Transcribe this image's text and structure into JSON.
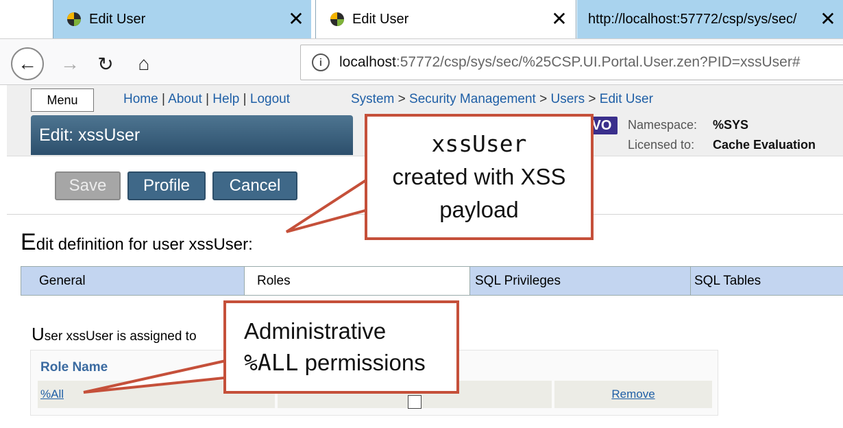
{
  "browser": {
    "tabs": [
      {
        "title": "Edit User",
        "close": "✕"
      },
      {
        "title": "Edit User",
        "close": "✕"
      },
      {
        "title": "http://localhost:57772/csp/sys/sec/",
        "close": "✕"
      }
    ],
    "nav": {
      "back": "←",
      "forward": "→",
      "reload": "↻",
      "home": "⌂"
    },
    "url": {
      "host": "localhost",
      "path": ":57772/csp/sys/sec/%25CSP.UI.Portal.User.zen?PID=xssUser#"
    },
    "info_icon": "i"
  },
  "header": {
    "menu_label": "Menu",
    "links": [
      "Home",
      "About",
      "Help",
      "Logout"
    ],
    "breadcrumb": [
      "System",
      "Security Management",
      "Users",
      "Edit User"
    ],
    "title": "Edit: xssUser",
    "badge": "VO",
    "namespace_label": "Namespace:",
    "namespace_value": "%SYS",
    "licensed_label": "Licensed to:",
    "licensed_value": "Cache Evaluation"
  },
  "toolbar": {
    "save_label": "Save",
    "profile_label": "Profile",
    "cancel_label": "Cancel"
  },
  "page": {
    "heading_first": "E",
    "heading_rest": "dit definition for user xssUser:",
    "tabs": [
      "General",
      "Roles",
      "SQL Privileges",
      "SQL Tables"
    ],
    "assigned_first": "U",
    "assigned_rest": "ser xssUser is assigned to"
  },
  "roles_table": {
    "header": "Role Name",
    "rows": [
      {
        "name": "%All",
        "action": "Remove"
      }
    ]
  },
  "callouts": {
    "c1_line1": "xssUser",
    "c1_line2": "created with XSS",
    "c1_line3": "payload",
    "c2_line1": "Administrative",
    "c2_line2_mono": "%ALL",
    "c2_line2_rest": " permissions"
  },
  "colors": {
    "accent": "#3f6888",
    "tab_inactive": "#a9d3ee",
    "callout_border": "#c5503a"
  }
}
